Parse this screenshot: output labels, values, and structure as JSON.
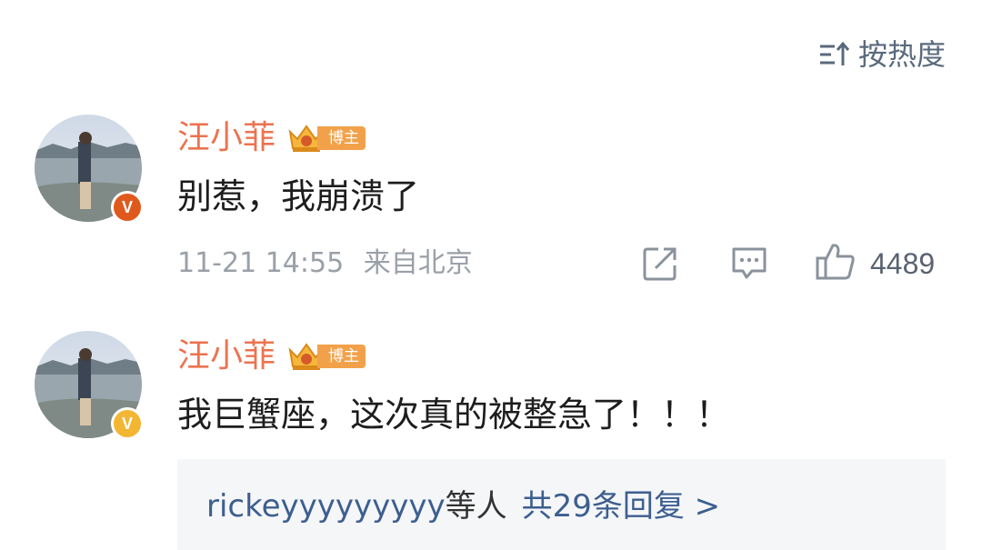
{
  "sort": {
    "label": "按热度",
    "icon": "sort-icon"
  },
  "comments": [
    {
      "username": "汪小菲",
      "badge_label": "博主",
      "verified_badge": "V",
      "verified_color": "#e0591c",
      "text": "别惹，我崩溃了",
      "time": "11-21 14:55",
      "location": "来自北京",
      "likes": "4489"
    },
    {
      "username": "汪小菲",
      "badge_label": "博主",
      "verified_badge": "V",
      "verified_color": "#f2b632",
      "text": "我巨蟹座，这次真的被整急了！！！",
      "replies": {
        "who": "rickeyyyyyyyyy",
        "suffix": "等人",
        "count": "共29条回复 >"
      }
    }
  ],
  "colors": {
    "username": "#eb7350",
    "link": "#3d5f8f",
    "meta": "#9aa0a8",
    "badge": "#f2a14a"
  }
}
